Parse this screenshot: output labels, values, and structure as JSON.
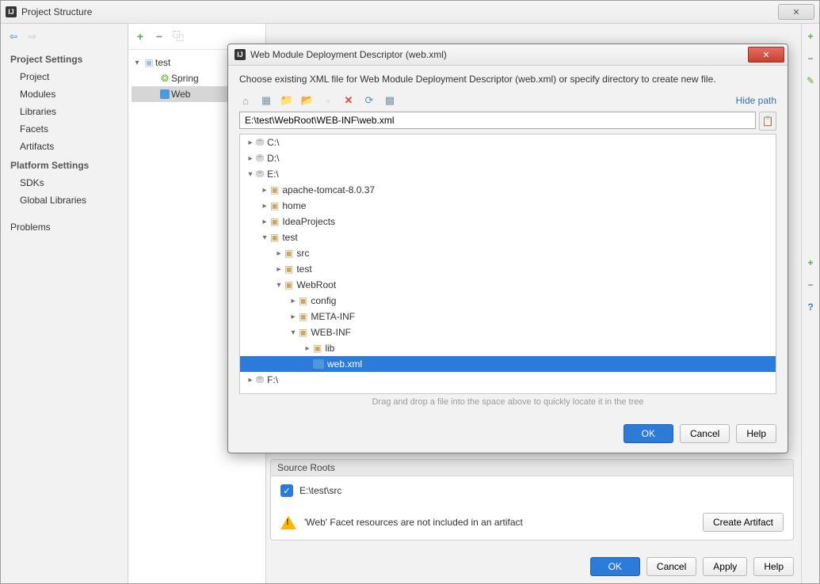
{
  "window": {
    "title": "Project Structure",
    "close_glyph": "✕"
  },
  "side_arrows": {
    "back": "⇦",
    "forward": "⇨"
  },
  "sidebar": {
    "section1": "Project Settings",
    "items1": [
      "Project",
      "Modules",
      "Libraries",
      "Facets",
      "Artifacts"
    ],
    "section2": "Platform Settings",
    "items2": [
      "SDKs",
      "Global Libraries"
    ],
    "problems": "Problems"
  },
  "mid_toolbar": {
    "plus": "+",
    "minus": "−",
    "copy": "⿻"
  },
  "mid_tree": {
    "root": "test",
    "spring": "Spring",
    "web": "Web"
  },
  "right_gutter": {
    "plus_top": "+",
    "minus_top": "−",
    "pencil": "✎",
    "plus_mid": "+",
    "minus_mid": "−",
    "question": "?"
  },
  "source_roots": {
    "header": "Source Roots",
    "path": "E:\\test\\src",
    "warning": "'Web' Facet resources are not included in an artifact",
    "create_artifact": "Create Artifact"
  },
  "bottom": {
    "ok": "OK",
    "cancel": "Cancel",
    "apply": "Apply",
    "help": "Help"
  },
  "modal": {
    "title": "Web Module Deployment Descriptor (web.xml)",
    "hint": "Choose existing XML file for Web Module Deployment Descriptor (web.xml) or specify directory to create new file.",
    "hide_path": "Hide path",
    "path": "E:\\test\\WebRoot\\WEB-INF\\web.xml",
    "drag_hint": "Drag and drop a file into the space above to quickly locate it in the tree",
    "buttons": {
      "ok": "OK",
      "cancel": "Cancel",
      "help": "Help"
    },
    "tree": {
      "c": "C:\\",
      "d": "D:\\",
      "e": "E:\\",
      "f": "F:\\",
      "tomcat": "apache-tomcat-8.0.37",
      "home": "home",
      "idea": "IdeaProjects",
      "test": "test",
      "src": "src",
      "test_sub": "test",
      "webroot": "WebRoot",
      "config": "config",
      "metainf": "META-INF",
      "webinf": "WEB-INF",
      "lib": "lib",
      "webxml": "web.xml"
    }
  }
}
